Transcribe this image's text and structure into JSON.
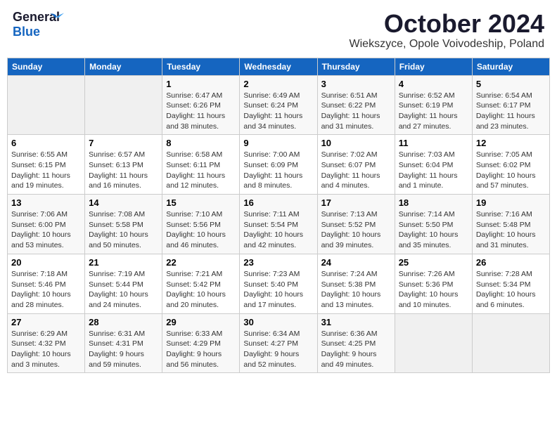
{
  "header": {
    "logo_general": "General",
    "logo_blue": "Blue",
    "title": "October 2024",
    "subtitle": "Wiekszyce, Opole Voivodeship, Poland"
  },
  "weekdays": [
    "Sunday",
    "Monday",
    "Tuesday",
    "Wednesday",
    "Thursday",
    "Friday",
    "Saturday"
  ],
  "weeks": [
    [
      {
        "day": "",
        "info": ""
      },
      {
        "day": "",
        "info": ""
      },
      {
        "day": "1",
        "info": "Sunrise: 6:47 AM\nSunset: 6:26 PM\nDaylight: 11 hours and 38 minutes."
      },
      {
        "day": "2",
        "info": "Sunrise: 6:49 AM\nSunset: 6:24 PM\nDaylight: 11 hours and 34 minutes."
      },
      {
        "day": "3",
        "info": "Sunrise: 6:51 AM\nSunset: 6:22 PM\nDaylight: 11 hours and 31 minutes."
      },
      {
        "day": "4",
        "info": "Sunrise: 6:52 AM\nSunset: 6:19 PM\nDaylight: 11 hours and 27 minutes."
      },
      {
        "day": "5",
        "info": "Sunrise: 6:54 AM\nSunset: 6:17 PM\nDaylight: 11 hours and 23 minutes."
      }
    ],
    [
      {
        "day": "6",
        "info": "Sunrise: 6:55 AM\nSunset: 6:15 PM\nDaylight: 11 hours and 19 minutes."
      },
      {
        "day": "7",
        "info": "Sunrise: 6:57 AM\nSunset: 6:13 PM\nDaylight: 11 hours and 16 minutes."
      },
      {
        "day": "8",
        "info": "Sunrise: 6:58 AM\nSunset: 6:11 PM\nDaylight: 11 hours and 12 minutes."
      },
      {
        "day": "9",
        "info": "Sunrise: 7:00 AM\nSunset: 6:09 PM\nDaylight: 11 hours and 8 minutes."
      },
      {
        "day": "10",
        "info": "Sunrise: 7:02 AM\nSunset: 6:07 PM\nDaylight: 11 hours and 4 minutes."
      },
      {
        "day": "11",
        "info": "Sunrise: 7:03 AM\nSunset: 6:04 PM\nDaylight: 11 hours and 1 minute."
      },
      {
        "day": "12",
        "info": "Sunrise: 7:05 AM\nSunset: 6:02 PM\nDaylight: 10 hours and 57 minutes."
      }
    ],
    [
      {
        "day": "13",
        "info": "Sunrise: 7:06 AM\nSunset: 6:00 PM\nDaylight: 10 hours and 53 minutes."
      },
      {
        "day": "14",
        "info": "Sunrise: 7:08 AM\nSunset: 5:58 PM\nDaylight: 10 hours and 50 minutes."
      },
      {
        "day": "15",
        "info": "Sunrise: 7:10 AM\nSunset: 5:56 PM\nDaylight: 10 hours and 46 minutes."
      },
      {
        "day": "16",
        "info": "Sunrise: 7:11 AM\nSunset: 5:54 PM\nDaylight: 10 hours and 42 minutes."
      },
      {
        "day": "17",
        "info": "Sunrise: 7:13 AM\nSunset: 5:52 PM\nDaylight: 10 hours and 39 minutes."
      },
      {
        "day": "18",
        "info": "Sunrise: 7:14 AM\nSunset: 5:50 PM\nDaylight: 10 hours and 35 minutes."
      },
      {
        "day": "19",
        "info": "Sunrise: 7:16 AM\nSunset: 5:48 PM\nDaylight: 10 hours and 31 minutes."
      }
    ],
    [
      {
        "day": "20",
        "info": "Sunrise: 7:18 AM\nSunset: 5:46 PM\nDaylight: 10 hours and 28 minutes."
      },
      {
        "day": "21",
        "info": "Sunrise: 7:19 AM\nSunset: 5:44 PM\nDaylight: 10 hours and 24 minutes."
      },
      {
        "day": "22",
        "info": "Sunrise: 7:21 AM\nSunset: 5:42 PM\nDaylight: 10 hours and 20 minutes."
      },
      {
        "day": "23",
        "info": "Sunrise: 7:23 AM\nSunset: 5:40 PM\nDaylight: 10 hours and 17 minutes."
      },
      {
        "day": "24",
        "info": "Sunrise: 7:24 AM\nSunset: 5:38 PM\nDaylight: 10 hours and 13 minutes."
      },
      {
        "day": "25",
        "info": "Sunrise: 7:26 AM\nSunset: 5:36 PM\nDaylight: 10 hours and 10 minutes."
      },
      {
        "day": "26",
        "info": "Sunrise: 7:28 AM\nSunset: 5:34 PM\nDaylight: 10 hours and 6 minutes."
      }
    ],
    [
      {
        "day": "27",
        "info": "Sunrise: 6:29 AM\nSunset: 4:32 PM\nDaylight: 10 hours and 3 minutes."
      },
      {
        "day": "28",
        "info": "Sunrise: 6:31 AM\nSunset: 4:31 PM\nDaylight: 9 hours and 59 minutes."
      },
      {
        "day": "29",
        "info": "Sunrise: 6:33 AM\nSunset: 4:29 PM\nDaylight: 9 hours and 56 minutes."
      },
      {
        "day": "30",
        "info": "Sunrise: 6:34 AM\nSunset: 4:27 PM\nDaylight: 9 hours and 52 minutes."
      },
      {
        "day": "31",
        "info": "Sunrise: 6:36 AM\nSunset: 4:25 PM\nDaylight: 9 hours and 49 minutes."
      },
      {
        "day": "",
        "info": ""
      },
      {
        "day": "",
        "info": ""
      }
    ]
  ]
}
